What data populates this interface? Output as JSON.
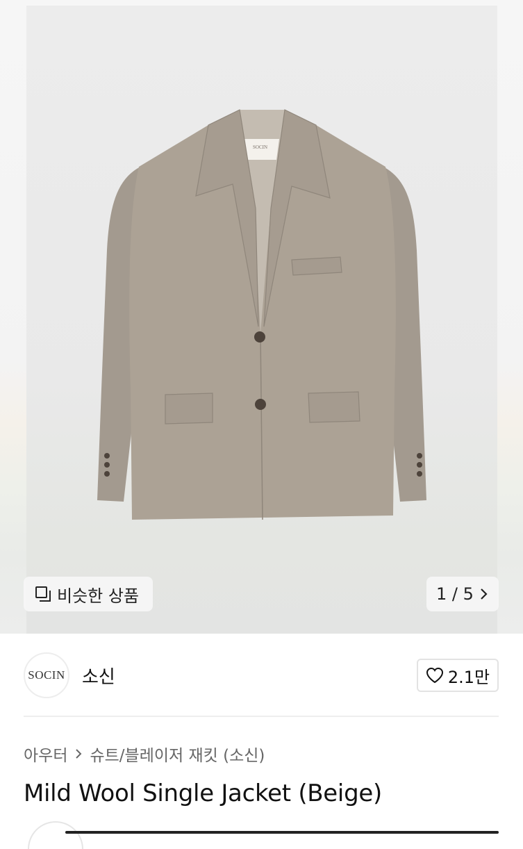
{
  "gallery": {
    "similar_label": "비슷한 상품",
    "pager_text": "1 / 5",
    "product_image_label": "SOCIN"
  },
  "seller": {
    "avatar_text": "SOCIN",
    "name": "소신",
    "likes": "2.1만"
  },
  "breadcrumb": {
    "items": [
      "아우터",
      "슈트/블레이저 재킷 (소신)"
    ]
  },
  "product": {
    "title": "Mild Wool Single Jacket (Beige)"
  },
  "icons": [
    "copy-icon",
    "chevron-right-icon",
    "heart-icon"
  ],
  "colors": {
    "jacket": "#aba196",
    "background": "#ececec"
  }
}
